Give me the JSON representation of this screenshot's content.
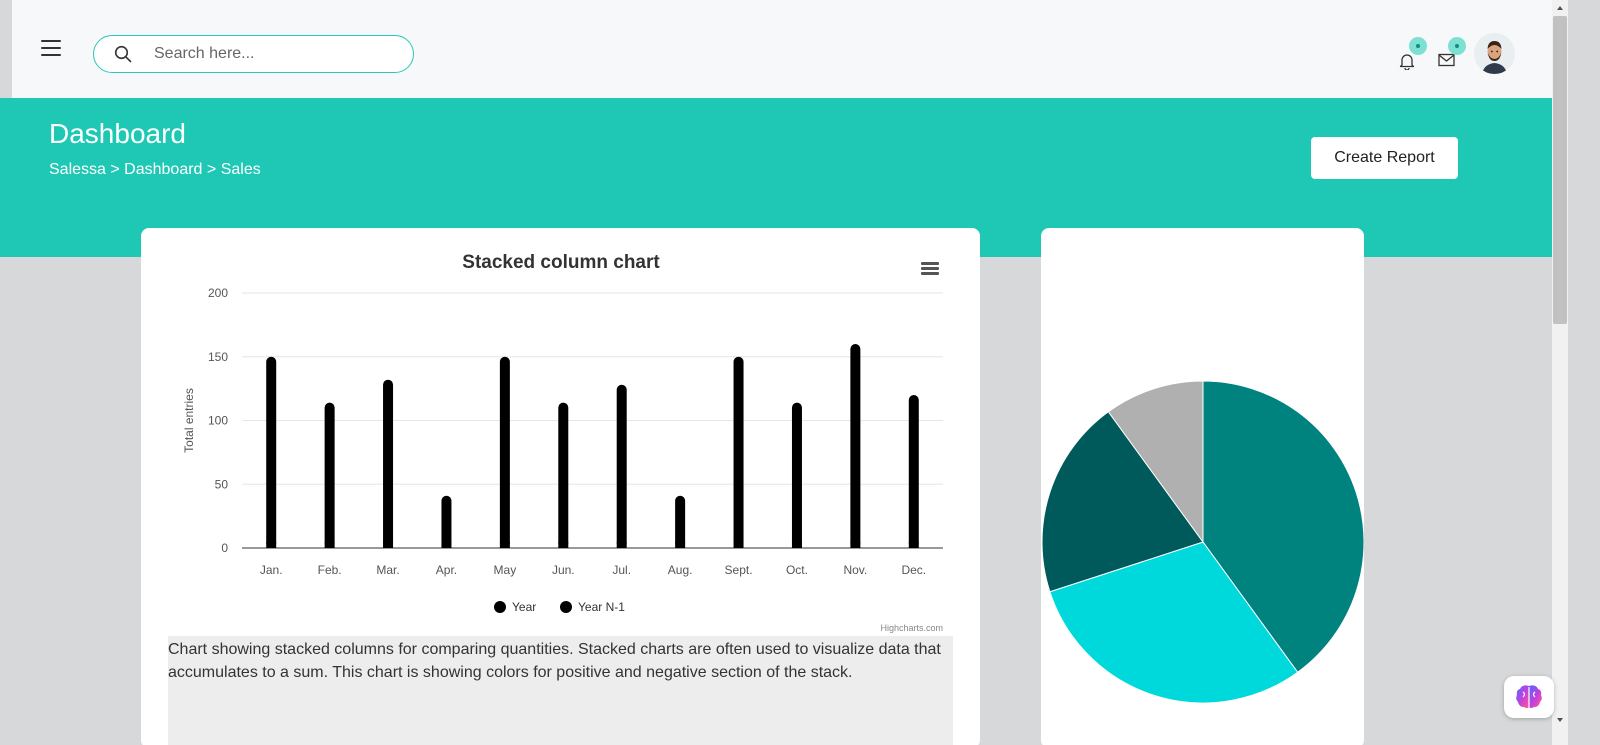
{
  "header": {
    "search": {
      "placeholder": "Search here..."
    },
    "icons": {
      "menu": "hamburger-icon",
      "search": "search-icon",
      "notifications": "bell-icon",
      "messages": "mail-icon"
    }
  },
  "hero": {
    "title": "Dashboard",
    "breadcrumb": [
      "Salessa",
      "Dashboard",
      "Sales"
    ],
    "breadcrumb_separator": ">",
    "create_button": "Create Report"
  },
  "colors": {
    "accent": "#1fc8b4",
    "pie_slices": [
      "#00827f",
      "#00d9dc",
      "#005a5b",
      "#b0b0b0"
    ]
  },
  "chart_data": [
    {
      "type": "bar",
      "title": "Stacked column chart",
      "ylabel": "Total entries",
      "xlabel": "",
      "ylim": [
        0,
        200
      ],
      "yticks": [
        0,
        50,
        100,
        150,
        200
      ],
      "grid": true,
      "legend_position": "bottom",
      "categories": [
        "Jan.",
        "Feb.",
        "Mar.",
        "Apr.",
        "May",
        "Jun.",
        "Jul.",
        "Aug.",
        "Sept.",
        "Oct.",
        "Nov.",
        "Dec."
      ],
      "series": [
        {
          "name": "Year",
          "values": [
            150,
            114,
            132,
            41,
            150,
            114,
            128,
            41,
            150,
            114,
            160,
            120
          ]
        },
        {
          "name": "Year N-1",
          "values": []
        }
      ],
      "credit": "Highcharts.com",
      "description": "Chart showing stacked columns for comparing quantities. Stacked charts are often used to visualize data that accumulates to a sum. This chart is showing colors for positive and negative section of the stack."
    },
    {
      "type": "pie",
      "values": [
        40,
        30,
        20,
        10
      ]
    }
  ]
}
